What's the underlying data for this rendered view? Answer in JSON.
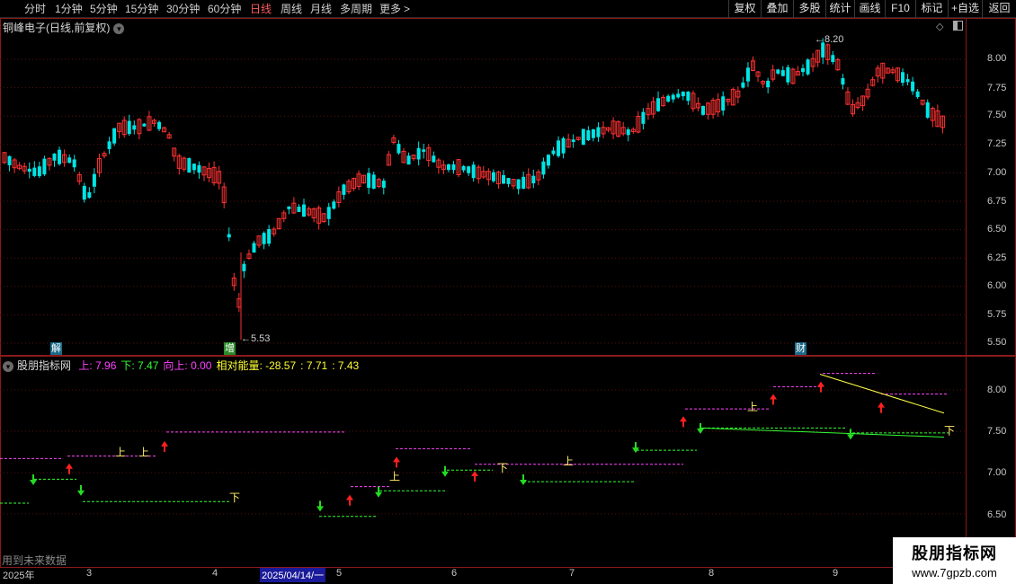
{
  "toolbar": {
    "periods": [
      "分时",
      "1分钟",
      "5分钟",
      "15分钟",
      "30分钟",
      "60分钟",
      "日线",
      "周线",
      "月线",
      "多周期",
      "更多"
    ],
    "active_period": "日线",
    "more_arrow": ">",
    "right_buttons": [
      "复权",
      "叠加",
      "多股",
      "统计",
      "画线",
      "F10",
      "标记",
      "+自选",
      "返回"
    ]
  },
  "main_pane": {
    "title": "铜峰电子(日线,前复权)",
    "price_axis": [
      "8.00",
      "7.75",
      "7.50",
      "7.25",
      "7.00",
      "6.75",
      "6.50",
      "6.25",
      "6.00",
      "5.75",
      "5.50"
    ],
    "high_marker": "8.20",
    "low_marker": "5.53",
    "badges": [
      "解",
      "增",
      "财"
    ],
    "candle_colors": {
      "up": "#ff3232",
      "down": "#00e5e5"
    }
  },
  "indicator_pane": {
    "name": "股朋指标网",
    "values": [
      {
        "label": "上:",
        "value": "7.96",
        "color": "#ff44ff"
      },
      {
        "label": "下:",
        "value": "7.47",
        "color": "#33ff33"
      },
      {
        "label": "向上:",
        "value": "0.00",
        "color": "#ff44ff"
      },
      {
        "label": "相对能量:",
        "value": "-28.57",
        "color": "#ffff33"
      },
      {
        "label": ":",
        "value": "7.71",
        "color": "#ffff33"
      },
      {
        "label": ":",
        "value": "7.43",
        "color": "#ffff33"
      }
    ],
    "price_axis": [
      "8.00",
      "7.50",
      "7.00",
      "6.50"
    ],
    "signal_up": "上",
    "signal_down": "下",
    "footer_note": "用到未来数据"
  },
  "date_axis": {
    "labels": [
      "2025年",
      "3",
      "4",
      "2025/04/14/一",
      "5",
      "6",
      "7",
      "8",
      "9"
    ]
  },
  "watermark": {
    "line1": "股朋指标网",
    "line2": "www.7gpzb.com"
  }
}
